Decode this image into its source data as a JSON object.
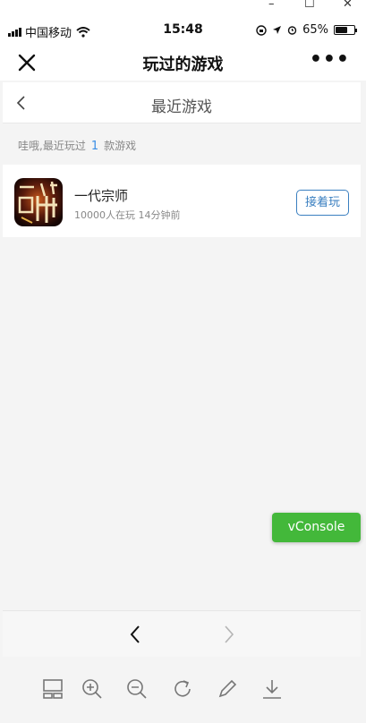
{
  "window_controls": [
    "minimize",
    "maximize",
    "close"
  ],
  "status_bar": {
    "carrier": "中国移动",
    "time": "15:48",
    "battery": "65%",
    "battery_level": 0.65
  },
  "nav_bar": {
    "title": "玩过的游戏",
    "close_icon": "close-icon",
    "more_icon": "more-icon"
  },
  "page": {
    "header_title": "最近游戏",
    "summary_prefix": "哇哦,最近玩过",
    "summary_count": "1",
    "summary_suffix": "款游戏"
  },
  "games": [
    {
      "name": "一代宗师",
      "meta": "10000人在玩 14分钟前",
      "action": "接着玩",
      "icon_text": "一代宗师"
    }
  ],
  "vconsole": {
    "label": "vConsole"
  },
  "toolbar": {
    "icons": [
      "layout-icon",
      "zoom-in-icon",
      "zoom-out-icon",
      "refresh-icon",
      "edit-icon",
      "download-icon"
    ]
  },
  "colors": {
    "accent_blue": "#3a7fc0",
    "count_blue": "#3a8ee6",
    "vconsole_green": "#43b83a",
    "background": "#f4f4f4"
  }
}
